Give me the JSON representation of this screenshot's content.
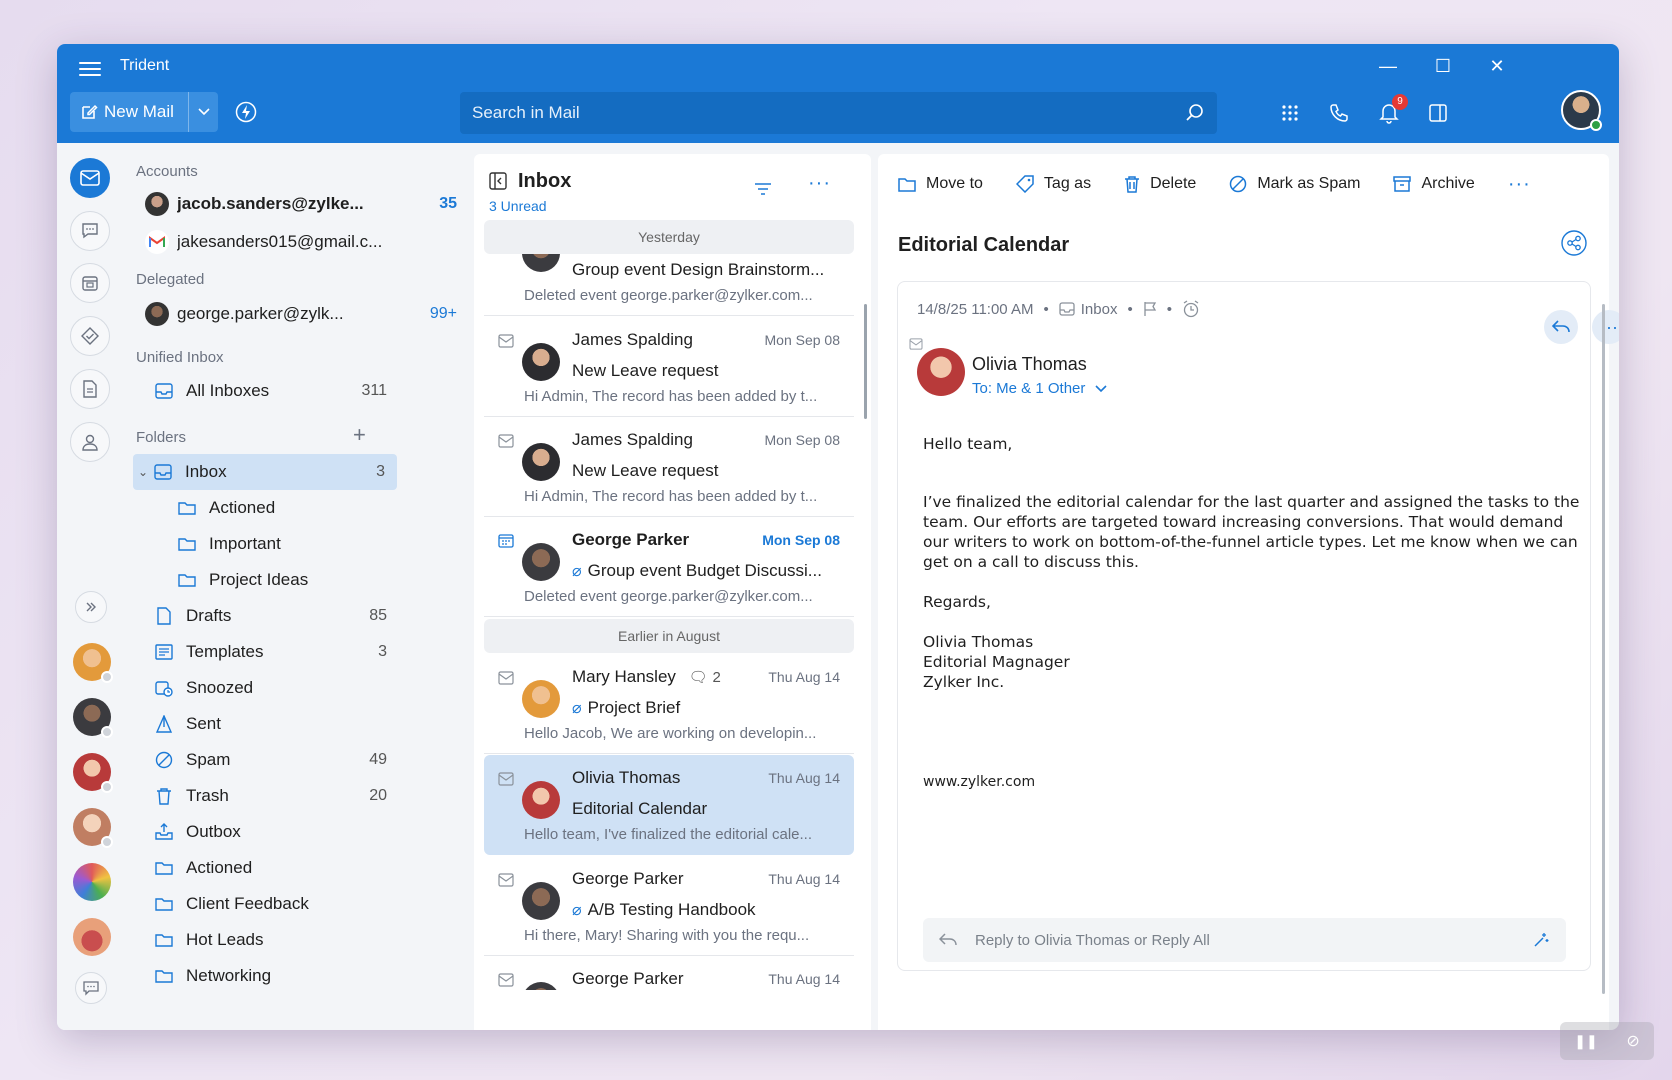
{
  "app": {
    "title": "Trident",
    "accent": "#1b79d6"
  },
  "titlebar": {
    "new_mail": "New Mail",
    "search_placeholder": "Search in Mail",
    "notification_count": "9"
  },
  "sidebar": {
    "accounts_label": "Accounts",
    "accounts": [
      {
        "email": "jacob.sanders@zylke...",
        "count": "35"
      },
      {
        "email": "jakesanders015@gmail.c...",
        "count": ""
      }
    ],
    "delegated_label": "Delegated",
    "delegated": [
      {
        "email": "george.parker@zylk...",
        "count": "99+"
      }
    ],
    "unified_label": "Unified Inbox",
    "all_inboxes": {
      "label": "All Inboxes",
      "count": "311"
    },
    "folders_label": "Folders",
    "folders": [
      {
        "label": "Inbox",
        "count": "3"
      },
      {
        "label": "Actioned",
        "count": ""
      },
      {
        "label": "Important",
        "count": ""
      },
      {
        "label": "Project Ideas",
        "count": ""
      },
      {
        "label": "Drafts",
        "count": "85"
      },
      {
        "label": "Templates",
        "count": "3"
      },
      {
        "label": "Snoozed",
        "count": ""
      },
      {
        "label": "Sent",
        "count": ""
      },
      {
        "label": "Spam",
        "count": "49"
      },
      {
        "label": "Trash",
        "count": "20"
      },
      {
        "label": "Outbox",
        "count": ""
      },
      {
        "label": "Actioned",
        "count": ""
      },
      {
        "label": "Client Feedback",
        "count": ""
      },
      {
        "label": "Hot Leads",
        "count": ""
      },
      {
        "label": "Networking",
        "count": ""
      }
    ]
  },
  "mail_list": {
    "title": "Inbox",
    "unread": "3 Unread",
    "group_yesterday": "Yesterday",
    "group_earlier": "Earlier in August",
    "items": [
      {
        "from": "",
        "date": "",
        "subject": "Group event Design Brainstorm...",
        "preview": "Deleted event george.parker@zylker.com..."
      },
      {
        "from": "James Spalding",
        "date": "Mon Sep 08",
        "subject": "New Leave request",
        "preview": "Hi Admin, The record has been added by t..."
      },
      {
        "from": "James Spalding",
        "date": "Mon Sep 08",
        "subject": "New Leave request",
        "preview": "Hi Admin, The record has been added by t..."
      },
      {
        "from": "George Parker",
        "date": "Mon Sep 08",
        "subject": "Group event Budget Discussi...",
        "preview": "Deleted event george.parker@zylker.com..."
      },
      {
        "from": "Mary Hansley",
        "thread_count": "2",
        "date": "Thu Aug 14",
        "subject": "Project Brief",
        "preview": "Hello Jacob, We are working on developin..."
      },
      {
        "from": "Olivia Thomas",
        "date": "Thu Aug 14",
        "subject": "Editorial Calendar",
        "preview": "Hello team, I've finalized the editorial cale..."
      },
      {
        "from": "George Parker",
        "date": "Thu Aug 14",
        "subject": "A/B Testing Handbook",
        "preview": "Hi there, Mary! Sharing with you the requ..."
      },
      {
        "from": "George Parker",
        "date": "Thu Aug 14",
        "subject": "",
        "preview": ""
      }
    ]
  },
  "reader": {
    "toolbar": {
      "move_to": "Move to",
      "tag_as": "Tag as",
      "delete": "Delete",
      "mark_spam": "Mark as Spam",
      "archive": "Archive"
    },
    "subject": "Editorial Calendar",
    "timestamp": "14/8/25 11:00 AM",
    "folder": "Inbox",
    "sender": "Olivia Thomas",
    "to_line": "To: Me & 1 Other",
    "body": {
      "greeting": "Hello team,",
      "paragraph": "I’ve finalized the editorial calendar for the last quarter and assigned the tasks to the team. Our efforts are targeted toward increasing conversions. That would demand our writers to work on bottom-of-the-funnel article types. Let me know when we can get on a call to discuss this.",
      "closing": "Regards,",
      "sig_name": "Olivia Thomas",
      "sig_title": "Editorial Magnager",
      "sig_company": "Zylker Inc.",
      "url": "www.zylker.com"
    },
    "reply_placeholder": "Reply to Olivia Thomas or Reply All"
  }
}
